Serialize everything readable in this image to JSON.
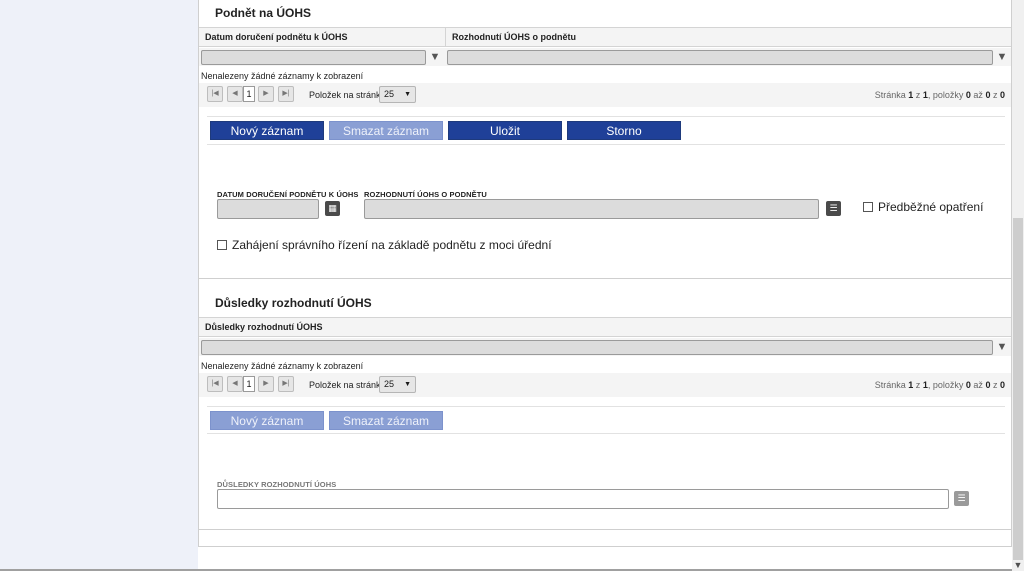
{
  "section1": {
    "title": "Podnět na ÚOHS",
    "grid": {
      "columns": [
        "Datum doručení podnětu k ÚOHS",
        "Rozhodnutí ÚOHS o podnětu"
      ],
      "no_records": "Nenalezeny žádné záznamy k zobrazení",
      "pager": {
        "current_page": "1",
        "page_size_label": "Položek na stránku",
        "page_size": "25",
        "info_prefix": "Stránka",
        "page": "1",
        "of": "z",
        "total_pages": "1",
        "items_label": ", položky",
        "from": "0",
        "to_label": "až",
        "to": "0",
        "of2": "z",
        "total": "0"
      }
    },
    "buttons": {
      "new": "Nový záznam",
      "delete": "Smazat záznam",
      "save": "Uložit",
      "cancel": "Storno"
    },
    "form": {
      "date_label": "DATUM DORUČENÍ PODNĚTU K ÚOHS",
      "date_value": "",
      "decision_label": "ROZHODNUTÍ ÚOHS O PODNĚTU",
      "decision_value": "",
      "preliminary_measure_label": "Předběžné opatření",
      "proceedings_label": "Zahájení správního řízení na základě podnětu z moci úřední"
    }
  },
  "section2": {
    "title": "Důsledky rozhodnutí ÚOHS",
    "grid": {
      "columns": [
        "Důsledky rozhodnutí ÚOHS"
      ],
      "no_records": "Nenalezeny žádné záznamy k zobrazení",
      "pager": {
        "current_page": "1",
        "page_size_label": "Položek na stránku",
        "page_size": "25",
        "info_prefix": "Stránka",
        "page": "1",
        "of": "z",
        "total_pages": "1",
        "items_label": ", položky",
        "from": "0",
        "to_label": "až",
        "to": "0",
        "of2": "z",
        "total": "0"
      }
    },
    "buttons": {
      "new": "Nový záznam",
      "delete": "Smazat záznam"
    },
    "form": {
      "consequences_label": "DŮSLEDKY ROZHODNUTÍ ÚOHS",
      "consequences_value": ""
    }
  },
  "colors": {
    "button_primary": "#1f4098",
    "button_disabled": "#8a9fd4",
    "page_background": "#eef1f9"
  },
  "icons": {
    "filter": "filter-icon",
    "calendar": "calendar-icon",
    "list": "list-icon",
    "first": "first-page-icon",
    "prev": "prev-page-icon",
    "next": "next-page-icon",
    "last": "last-page-icon",
    "dropdown": "chevron-down-icon"
  }
}
